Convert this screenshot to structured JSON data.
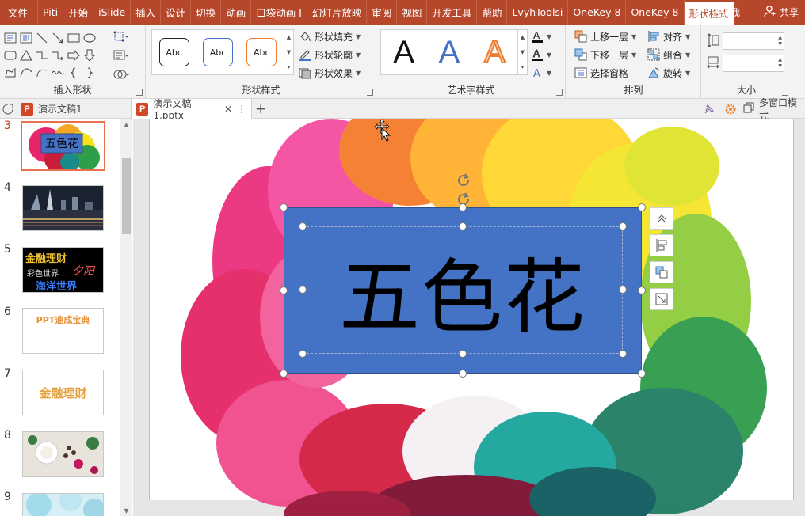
{
  "ribbon_tabs": [
    "文件",
    "Piti",
    "开始",
    "iSlide",
    "插入",
    "设计",
    "切换",
    "动画",
    "口袋动画 I",
    "幻灯片放映",
    "审阅",
    "视图",
    "开发工具",
    "帮助",
    "LvyhToolsi",
    "OneKey 8",
    "OneKey 8",
    "形状格式"
  ],
  "active_tab_index": 17,
  "tell_me": "告诉我",
  "share": "共享",
  "groups": {
    "insert_shapes": "插入形状",
    "shape_styles": "形状样式",
    "wordart_styles": "艺术字样式",
    "arrange": "排列",
    "size": "大小"
  },
  "style_box_label": "Abc",
  "shape_cmds": {
    "fill": "形状填充",
    "outline": "形状轮廓",
    "effects": "形状效果"
  },
  "wordart_letter": "A",
  "arrange_cmds": {
    "bring_forward": "上移一层",
    "send_backward": "下移一层",
    "selection_pane": "选择窗格",
    "align": "对齐",
    "group": "组合",
    "rotate": "旋转"
  },
  "doc_tabs": {
    "inactive": "演示文稿1",
    "active": "演示文稿1.pptx",
    "ppt_icon_letter": "P",
    "right_label": "多窗口模式"
  },
  "slides": [
    {
      "number": "3",
      "selected": true,
      "label": "五色花"
    },
    {
      "number": "4",
      "selected": false,
      "label": ""
    },
    {
      "number": "5",
      "selected": false,
      "lines": [
        "金融理财",
        "彩色世界",
        "夕阳",
        "海洋世界"
      ]
    },
    {
      "number": "6",
      "selected": false,
      "label": "PPT速成宝典"
    },
    {
      "number": "7",
      "selected": false,
      "label": "金融理财"
    },
    {
      "number": "8",
      "selected": false,
      "label": ""
    },
    {
      "number": "9",
      "selected": false,
      "label": ""
    }
  ],
  "slide_shape": {
    "text": "五色花",
    "fill": "#4472c4"
  },
  "colors": {
    "accent": "#b7472a",
    "ppt_icon": "#d24726",
    "selection_border": "#e8704e"
  }
}
